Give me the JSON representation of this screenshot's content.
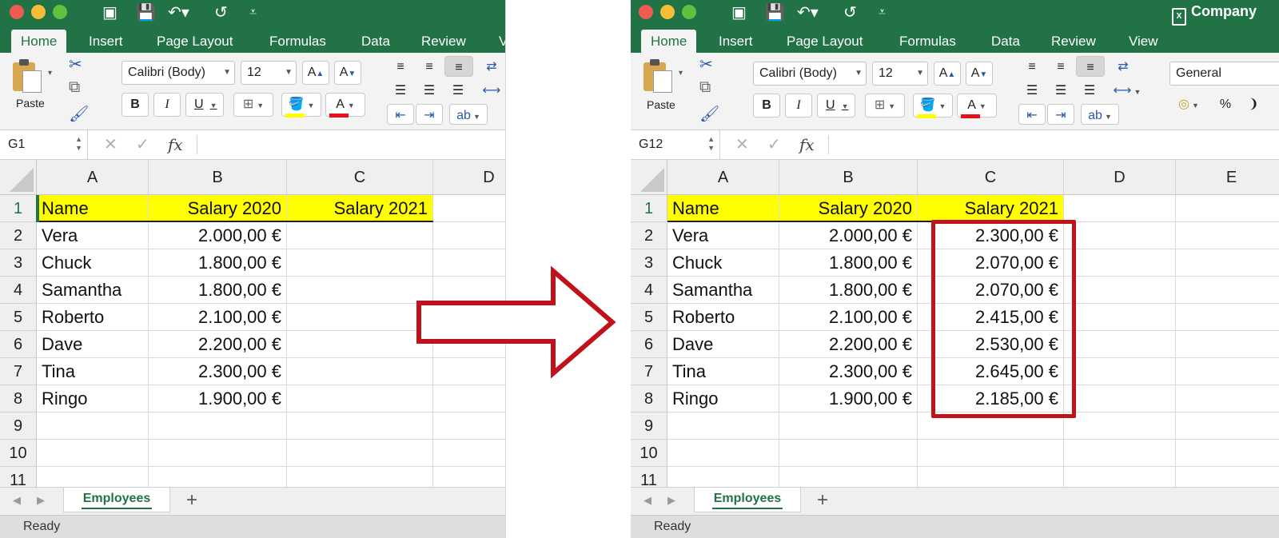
{
  "ribbon": {
    "tabs": [
      "Home",
      "Insert",
      "Page Layout",
      "Formulas",
      "Data",
      "Review",
      "View"
    ],
    "tabs_left_visible": [
      "Home",
      "Insert",
      "Page Layout",
      "Formulas",
      "Data",
      "Review",
      "V"
    ],
    "paste_label": "Paste",
    "font_name": "Calibri (Body)",
    "font_size": "12",
    "number_format": "General",
    "bold": "B",
    "italic": "I",
    "underline": "U",
    "font_color_glyph": "A",
    "percent": "%"
  },
  "left": {
    "name_box": "G1",
    "headers": [
      "A",
      "B",
      "C",
      "D"
    ],
    "rows": [
      {
        "num": "1",
        "a": "Name",
        "b": "Salary 2020",
        "c": "Salary 2021"
      },
      {
        "num": "2",
        "a": "Vera",
        "b": "2.000,00 €",
        "c": ""
      },
      {
        "num": "3",
        "a": "Chuck",
        "b": "1.800,00 €",
        "c": ""
      },
      {
        "num": "4",
        "a": "Samantha",
        "b": "1.800,00 €",
        "c": ""
      },
      {
        "num": "5",
        "a": "Roberto",
        "b": "2.100,00 €",
        "c": ""
      },
      {
        "num": "6",
        "a": "Dave",
        "b": "2.200,00 €",
        "c": ""
      },
      {
        "num": "7",
        "a": "Tina",
        "b": "2.300,00 €",
        "c": ""
      },
      {
        "num": "8",
        "a": "Ringo",
        "b": "1.900,00 €",
        "c": ""
      },
      {
        "num": "9",
        "a": "",
        "b": "",
        "c": ""
      },
      {
        "num": "10",
        "a": "",
        "b": "",
        "c": ""
      },
      {
        "num": "11",
        "a": "",
        "b": "",
        "c": ""
      }
    ]
  },
  "right": {
    "window_title": "Company",
    "name_box": "G12",
    "headers": [
      "A",
      "B",
      "C",
      "D",
      "E"
    ],
    "rows": [
      {
        "num": "1",
        "a": "Name",
        "b": "Salary 2020",
        "c": "Salary 2021"
      },
      {
        "num": "2",
        "a": "Vera",
        "b": "2.000,00 €",
        "c": "2.300,00 €"
      },
      {
        "num": "3",
        "a": "Chuck",
        "b": "1.800,00 €",
        "c": "2.070,00 €"
      },
      {
        "num": "4",
        "a": "Samantha",
        "b": "1.800,00 €",
        "c": "2.070,00 €"
      },
      {
        "num": "5",
        "a": "Roberto",
        "b": "2.100,00 €",
        "c": "2.415,00 €"
      },
      {
        "num": "6",
        "a": "Dave",
        "b": "2.200,00 €",
        "c": "2.530,00 €"
      },
      {
        "num": "7",
        "a": "Tina",
        "b": "2.300,00 €",
        "c": "2.645,00 €"
      },
      {
        "num": "8",
        "a": "Ringo",
        "b": "1.900,00 €",
        "c": "2.185,00 €"
      },
      {
        "num": "9",
        "a": "",
        "b": "",
        "c": ""
      },
      {
        "num": "10",
        "a": "",
        "b": "",
        "c": ""
      },
      {
        "num": "11",
        "a": "",
        "b": "",
        "c": ""
      }
    ]
  },
  "sheet_tab": "Employees",
  "add_sheet": "+",
  "status": "Ready",
  "colors": {
    "excel_green": "#217346",
    "header_highlight": "#ffff00",
    "annotation_red": "#c0121b"
  }
}
